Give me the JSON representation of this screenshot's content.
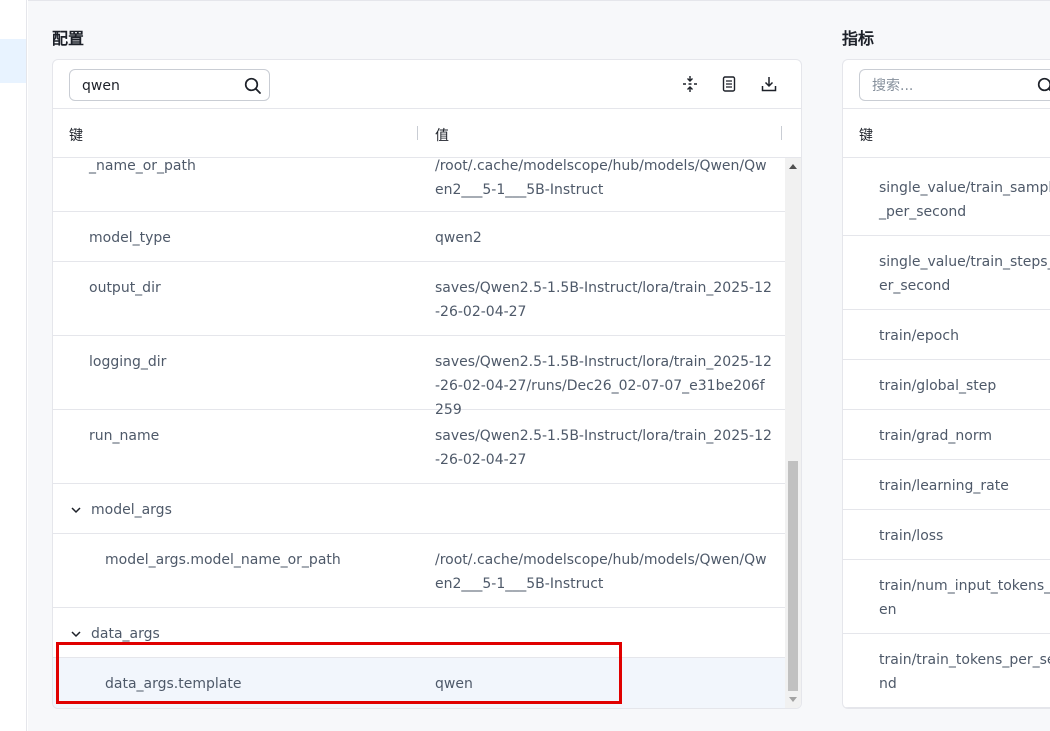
{
  "config_panel": {
    "title": "配置",
    "search": {
      "value": "qwen",
      "placeholder": ""
    },
    "toolbar_icons": [
      "collapse-all-icon",
      "copy-doc-icon",
      "download-icon"
    ],
    "columns": {
      "key": "键",
      "value": "值"
    },
    "rows": [
      {
        "key": "_name_or_path",
        "value": "/root/.cache/modelscope/hub/models/Qwen/Qwen2___5-1___5B-Instruct"
      },
      {
        "key": "model_type",
        "value": "qwen2"
      },
      {
        "key": "output_dir",
        "value": "saves/Qwen2.5-1.5B-Instruct/lora/train_2025-12-26-02-04-27"
      },
      {
        "key": "logging_dir",
        "value": "saves/Qwen2.5-1.5B-Instruct/lora/train_2025-12-26-02-04-27/runs/Dec26_02-07-07_e31be206f259"
      },
      {
        "key": "run_name",
        "value": "saves/Qwen2.5-1.5B-Instruct/lora/train_2025-12-26-02-04-27"
      },
      {
        "key": "model_args",
        "value": ""
      },
      {
        "key": "model_args.model_name_or_path",
        "value": "/root/.cache/modelscope/hub/models/Qwen/Qwen2___5-1___5B-Instruct"
      },
      {
        "key": "data_args",
        "value": ""
      },
      {
        "key": "data_args.template",
        "value": "qwen"
      }
    ]
  },
  "metrics_panel": {
    "title": "指标",
    "search": {
      "value": "",
      "placeholder": "搜索..."
    },
    "columns": {
      "key": "键"
    },
    "rows": [
      {
        "key": "single_value/train_samples_per_second"
      },
      {
        "key": "single_value/train_steps_per_second"
      },
      {
        "key": "train/epoch"
      },
      {
        "key": "train/global_step"
      },
      {
        "key": "train/grad_norm"
      },
      {
        "key": "train/learning_rate"
      },
      {
        "key": "train/loss"
      },
      {
        "key": "train/num_input_tokens_seen"
      },
      {
        "key": "train/train_tokens_per_second"
      }
    ]
  },
  "colors": {
    "highlight": "#e00000",
    "selected_row": "#f2f6fc",
    "sidebar_active": "#e8f3ff"
  }
}
